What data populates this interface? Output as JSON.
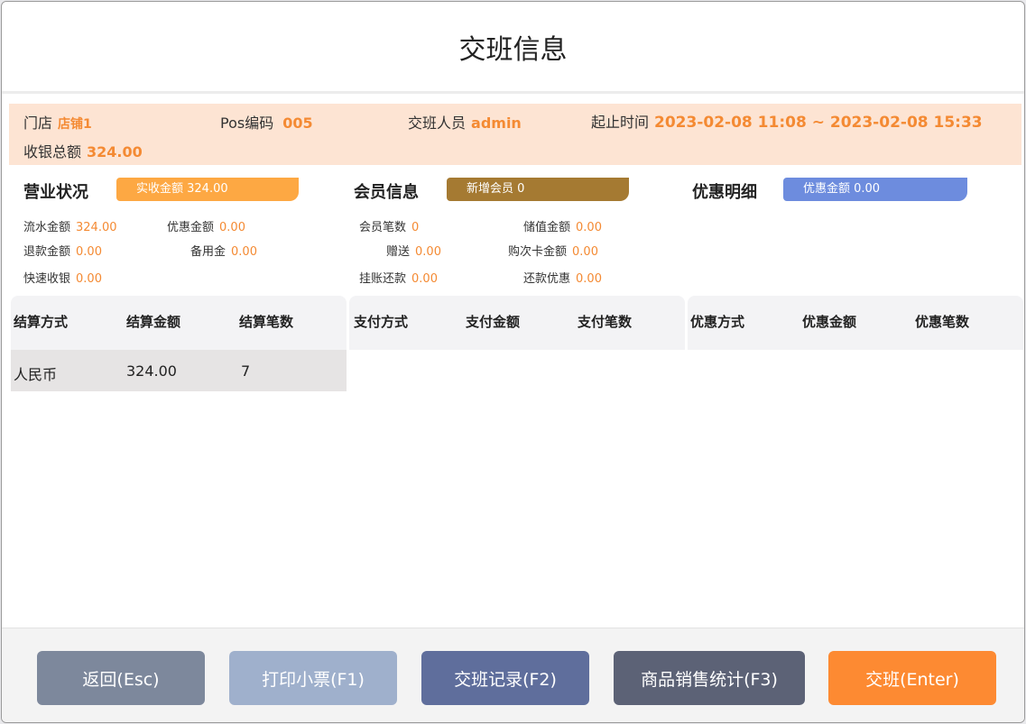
{
  "title": "交班信息",
  "info": {
    "store_label": "门店",
    "store_value": "店铺1",
    "pos_label": "Pos编码",
    "pos_value": "005",
    "staff_label": "交班人员",
    "staff_value": "admin",
    "time_label": "起止时间",
    "time_value": "2023-02-08 11:08 ~ 2023-02-08 15:33",
    "total_label": "收银总额",
    "total_value": "324.00"
  },
  "business": {
    "title": "营业状况",
    "pill": "实收金额 324.00",
    "flow_label": "流水金额",
    "flow_value": "324.00",
    "discount_label": "优惠金额",
    "discount_value": "0.00",
    "refund_label": "退款金额",
    "refund_value": "0.00",
    "reserve_label": "备用金",
    "reserve_value": "0.00",
    "quick_label": "快速收银",
    "quick_value": "0.00"
  },
  "member": {
    "title": "会员信息",
    "pill": "新增会员 0",
    "count_label": "会员笔数",
    "count_value": "0",
    "stored_label": "储值金额",
    "stored_value": "0.00",
    "gift_label": "赠送",
    "gift_value": "0.00",
    "card_label": "购次卡金额",
    "card_value": "0.00",
    "credit_label": "挂账还款",
    "credit_value": "0.00",
    "repay_label": "还款优惠",
    "repay_value": "0.00"
  },
  "promo": {
    "title": "优惠明细",
    "pill": "优惠金额 0.00"
  },
  "settle_table": {
    "headers": [
      "结算方式",
      "结算金额",
      "结算笔数"
    ],
    "rows": [
      [
        "人民币",
        "324.00",
        "7"
      ]
    ]
  },
  "pay_table": {
    "headers": [
      "支付方式",
      "支付金额",
      "支付笔数"
    ]
  },
  "promo_table": {
    "headers": [
      "优惠方式",
      "优惠金额",
      "优惠笔数"
    ]
  },
  "buttons": {
    "back": "返回(Esc)",
    "print": "打印小票(F1)",
    "records": "交班记录(F2)",
    "sales": "商品销售统计(F3)",
    "shift": "交班(Enter)"
  },
  "colors": {
    "accent": "#f48a33",
    "back_btn": "#7d889c",
    "print_btn": "#9fb0cc",
    "records_btn": "#5f6e9c",
    "sales_btn": "#5c6276",
    "shift_btn": "#fd8a32"
  }
}
